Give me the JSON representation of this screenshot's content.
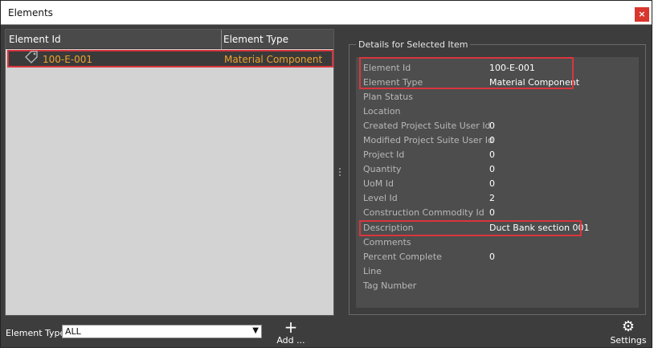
{
  "window": {
    "title": "Elements",
    "close_label": "×"
  },
  "grid": {
    "columns": [
      "Element Id",
      "Element Type"
    ],
    "rows": [
      {
        "id": "100-E-001",
        "type": "Material Component",
        "icon": "tag-icon"
      }
    ]
  },
  "details": {
    "legend": "Details for Selected Item",
    "properties": [
      {
        "label": "Element Id",
        "value": "100-E-001"
      },
      {
        "label": "Element Type",
        "value": "Material Component"
      },
      {
        "label": "Plan Status",
        "value": ""
      },
      {
        "label": "Location",
        "value": ""
      },
      {
        "label": "Created Project Suite User Id",
        "value": "0"
      },
      {
        "label": "Modified Project Suite User Id",
        "value": "0"
      },
      {
        "label": "Project Id",
        "value": "0"
      },
      {
        "label": "Quantity",
        "value": "0"
      },
      {
        "label": "UoM Id",
        "value": "0"
      },
      {
        "label": "Level Id",
        "value": "2"
      },
      {
        "label": "Construction Commodity Id",
        "value": "0"
      },
      {
        "label": "Description",
        "value": "Duct Bank section 001"
      },
      {
        "label": "Comments",
        "value": ""
      },
      {
        "label": "Percent Complete",
        "value": "0"
      },
      {
        "label": "Line",
        "value": ""
      },
      {
        "label": "Tag Number",
        "value": ""
      }
    ]
  },
  "footer": {
    "element_type_label": "Element Type:",
    "element_type_value": "ALL",
    "add_label": "Add ...",
    "settings_label": "Settings ..."
  },
  "colors": {
    "highlight": "#d9363e",
    "accent_text": "#f0a22d",
    "close": "#d9362e"
  }
}
